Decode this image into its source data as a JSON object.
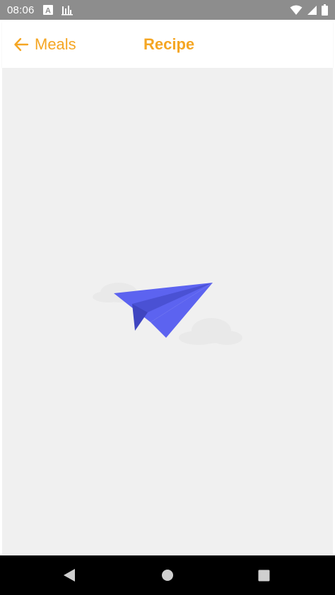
{
  "status_bar": {
    "time": "08:06",
    "left_icons": [
      "a-badge-icon",
      "bar-chart-icon"
    ],
    "right_icons": [
      "wifi-icon",
      "cellular-signal-icon",
      "battery-icon"
    ]
  },
  "header": {
    "back_label": "Meals",
    "title": "Recipe",
    "accent_color": "#f5a623"
  },
  "content": {
    "state": "loading",
    "illustration": "paper-plane-icon",
    "illustration_color": "#5c63f0",
    "background_color": "#f0f0f0"
  },
  "nav_bar": {
    "buttons": [
      "back-triangle-icon",
      "home-circle-icon",
      "recents-square-icon"
    ]
  }
}
